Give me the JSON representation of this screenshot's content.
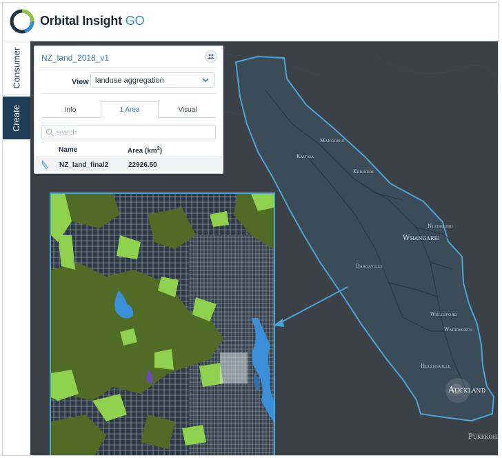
{
  "app": {
    "brand": "Orbital Insight",
    "brand_suffix": "GO"
  },
  "rail": {
    "tabs": [
      {
        "label": "Consumer"
      },
      {
        "label": "Create"
      }
    ]
  },
  "panel": {
    "title": "NZ_land_2018_v1",
    "view": {
      "label": "View",
      "value": "landuse aggregation"
    },
    "tabs": [
      {
        "label": "Info"
      },
      {
        "label": "1 Area",
        "active": true
      },
      {
        "label": "Visual"
      }
    ],
    "search": {
      "placeholder": "search",
      "value": ""
    },
    "columns": {
      "name": "Name",
      "area": "Area (km",
      "area_sup": "2",
      "area_close": ")"
    },
    "rows": [
      {
        "name": "NZ_land_final2",
        "area": "22926.50"
      }
    ]
  },
  "map": {
    "towns": [
      {
        "name": "Mangonui"
      },
      {
        "name": "Kaitaia"
      },
      {
        "name": "Kerikeri"
      },
      {
        "name": "Nounguru"
      },
      {
        "name": "Whangarei"
      },
      {
        "name": "Dargaville"
      },
      {
        "name": "Wellsford"
      },
      {
        "name": "Warkworth"
      },
      {
        "name": "Helensville"
      },
      {
        "name": "Auckland"
      },
      {
        "name": "Pukekohe"
      }
    ]
  },
  "colors": {
    "accent": "#2f7fc0",
    "rail_active": "#1f3d57",
    "map_background": "#3b4147",
    "region_outline": "#4aa6d6",
    "forest": "#4f6b26",
    "grass": "#8fd14f",
    "water": "#3a8fd8"
  },
  "icons": [
    "logo-ring",
    "share-icon",
    "chevron-down-icon",
    "search-icon",
    "layer-icon"
  ]
}
